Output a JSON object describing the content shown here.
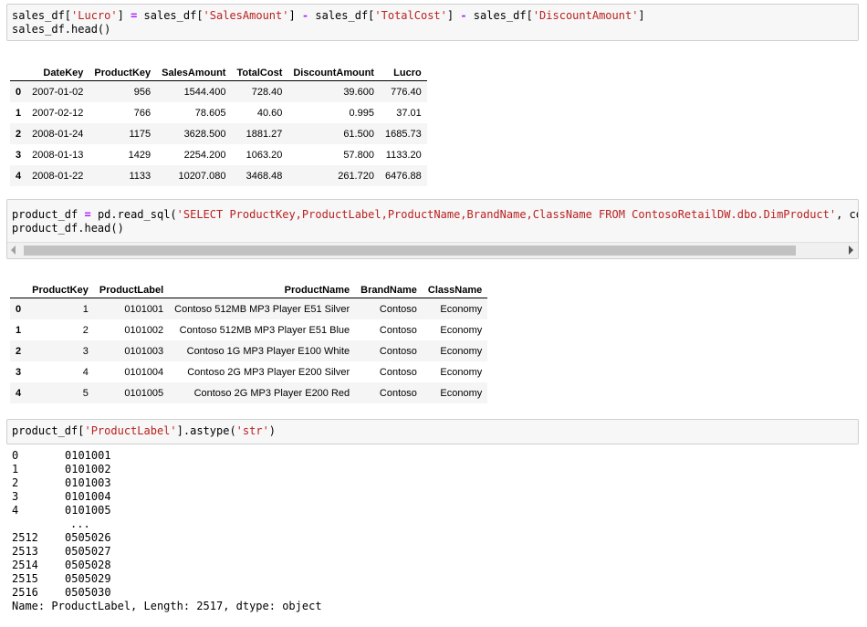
{
  "cell1": {
    "lines": [
      [
        "sales_df[",
        "'Lucro'",
        "] ",
        "=",
        " sales_df[",
        "'SalesAmount'",
        "] ",
        "-",
        " sales_df[",
        "'TotalCost'",
        "] ",
        "-",
        " sales_df[",
        "'DiscountAmount'",
        "]"
      ],
      [
        "sales_df",
        ".",
        "head()"
      ]
    ]
  },
  "sales_table": {
    "columns": [
      "",
      "DateKey",
      "ProductKey",
      "SalesAmount",
      "TotalCost",
      "DiscountAmount",
      "Lucro"
    ],
    "rows": [
      [
        "0",
        "2007-01-02",
        "956",
        "1544.400",
        "728.40",
        "39.600",
        "776.40"
      ],
      [
        "1",
        "2007-02-12",
        "766",
        "78.605",
        "40.60",
        "0.995",
        "37.01"
      ],
      [
        "2",
        "2008-01-24",
        "1175",
        "3628.500",
        "1881.27",
        "61.500",
        "1685.73"
      ],
      [
        "3",
        "2008-01-13",
        "1429",
        "2254.200",
        "1063.20",
        "57.800",
        "1133.20"
      ],
      [
        "4",
        "2008-01-22",
        "1133",
        "10207.080",
        "3468.48",
        "261.720",
        "6476.88"
      ]
    ]
  },
  "cell2": {
    "line1_prefix": "product_df ",
    "line1_eq": "=",
    "line1_mid": " pd.read_sql(",
    "line1_str": "'SELECT ProductKey,ProductLabel,ProductName,BrandName,ClassName FROM ContosoRetailDW.dbo.DimProduct'",
    "line1_tail": ", co",
    "line2": "product_df.head()"
  },
  "product_table": {
    "columns": [
      "",
      "ProductKey",
      "ProductLabel",
      "ProductName",
      "BrandName",
      "ClassName"
    ],
    "rows": [
      [
        "0",
        "1",
        "0101001",
        "Contoso 512MB MP3 Player E51 Silver",
        "Contoso",
        "Economy"
      ],
      [
        "1",
        "2",
        "0101002",
        "Contoso 512MB MP3 Player E51 Blue",
        "Contoso",
        "Economy"
      ],
      [
        "2",
        "3",
        "0101003",
        "Contoso 1G MP3 Player E100 White",
        "Contoso",
        "Economy"
      ],
      [
        "3",
        "4",
        "0101004",
        "Contoso 2G MP3 Player E200 Silver",
        "Contoso",
        "Economy"
      ],
      [
        "4",
        "5",
        "0101005",
        "Contoso 2G MP3 Player E200 Red",
        "Contoso",
        "Economy"
      ]
    ]
  },
  "cell3": {
    "prefix": "product_df[",
    "str1": "'ProductLabel'",
    "mid": "].astype(",
    "str2": "'str'",
    "suffix": ")"
  },
  "series_output": {
    "head": [
      [
        "0",
        "0101001"
      ],
      [
        "1",
        "0101002"
      ],
      [
        "2",
        "0101003"
      ],
      [
        "3",
        "0101004"
      ],
      [
        "4",
        "0101005"
      ]
    ],
    "ellipsis": "...",
    "tail": [
      [
        "2512",
        "0505026"
      ],
      [
        "2513",
        "0505027"
      ],
      [
        "2514",
        "0505028"
      ],
      [
        "2515",
        "0505029"
      ],
      [
        "2516",
        "0505030"
      ]
    ],
    "footer": "Name: ProductLabel, Length: 2517, dtype: object"
  }
}
